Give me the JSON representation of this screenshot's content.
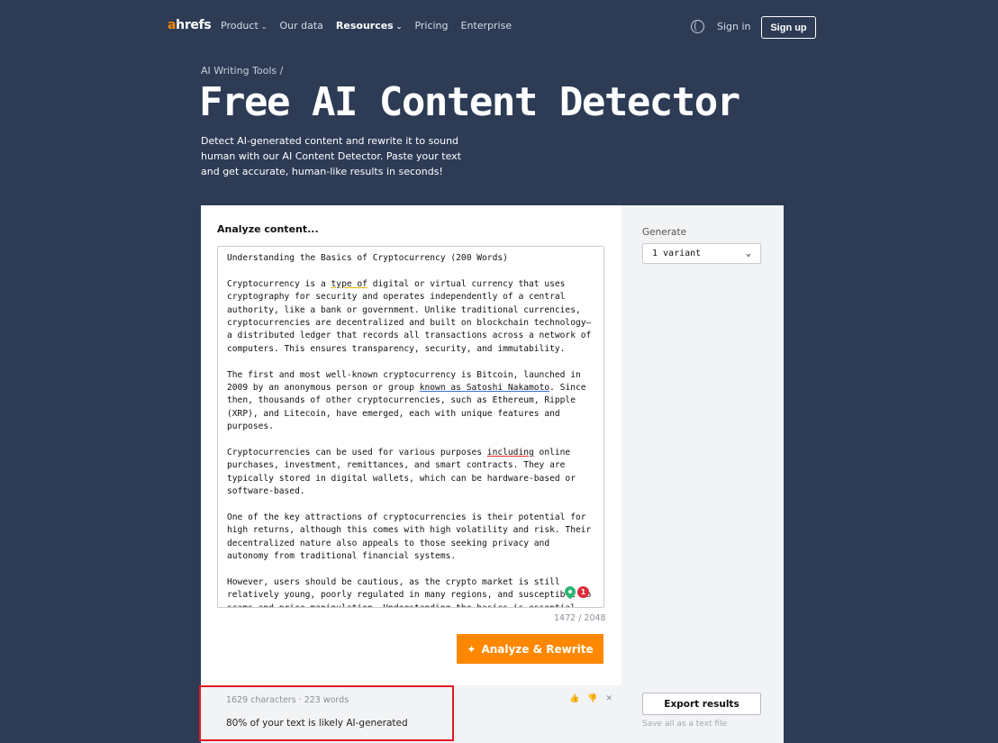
{
  "nav": {
    "logo_a": "a",
    "logo_rest": "hrefs",
    "links": [
      {
        "label": "Product",
        "dropdown": true
      },
      {
        "label": "Our data",
        "dropdown": false
      },
      {
        "label": "Resources",
        "dropdown": true
      },
      {
        "label": "Pricing",
        "dropdown": false
      },
      {
        "label": "Enterprise",
        "dropdown": false
      }
    ],
    "signin": "Sign in",
    "signup": "Sign up"
  },
  "hero": {
    "breadcrumb": "AI Writing Tools /",
    "title": "Free AI Content Detector",
    "subtitle": "Detect AI-generated content and rewrite it to sound human with our AI Content Detector. Paste your text and get accurate, human-like results in seconds!"
  },
  "editor": {
    "label": "Analyze content...",
    "heading": "Understanding the Basics of Cryptocurrency (200 Words)",
    "p1_a": "Cryptocurrency is a ",
    "p1_u": "type of",
    "p1_b": " digital or virtual currency that uses cryptography for security and operates independently of a central authority, like a bank or government. Unlike traditional currencies, cryptocurrencies are decentralized and built on blockchain technology—a distributed ledger that records all transactions across a network of computers. This ensures transparency, security, and immutability.",
    "p2_a": "The first and most well-known cryptocurrency is Bitcoin, launched in 2009 by an anonymous person or group ",
    "p2_u": "known as Satoshi Nakamoto",
    "p2_b": ". Since then, thousands of other cryptocurrencies, such as Ethereum, Ripple (XRP), and Litecoin, have emerged, each with unique features and purposes.",
    "p3_a": "Cryptocurrencies can be used for various purposes ",
    "p3_u": "including",
    "p3_b": " online purchases, investment, remittances, and smart contracts. They are typically stored in digital wallets, which can be hardware-based or software-based.",
    "p4": "One of the key attractions of cryptocurrencies is their potential for high returns, although this comes with high volatility and risk. Their decentralized nature also appeals to those seeking privacy and autonomy from traditional financial systems.",
    "p5": "However, users should be cautious, as the crypto market is still relatively young, poorly regulated in many regions, and susceptible to scams and price manipulation. Understanding the basics is essential before investing or transacting with cryptocurrency.",
    "error_count": "1",
    "counter": "1472 / 2048",
    "analyze_button": "Analyze & Rewrite"
  },
  "result": {
    "meta": "1629 characters · 223 words",
    "text": "80% of your text is likely AI-generated"
  },
  "sidebar": {
    "generate_label": "Generate",
    "variant_selected": "1 variant",
    "export_button": "Export results",
    "export_hint": "Save all as a text file"
  },
  "colors": {
    "background": "#2d3b55",
    "accent": "#ff8800",
    "highlight": "#e01b24"
  }
}
